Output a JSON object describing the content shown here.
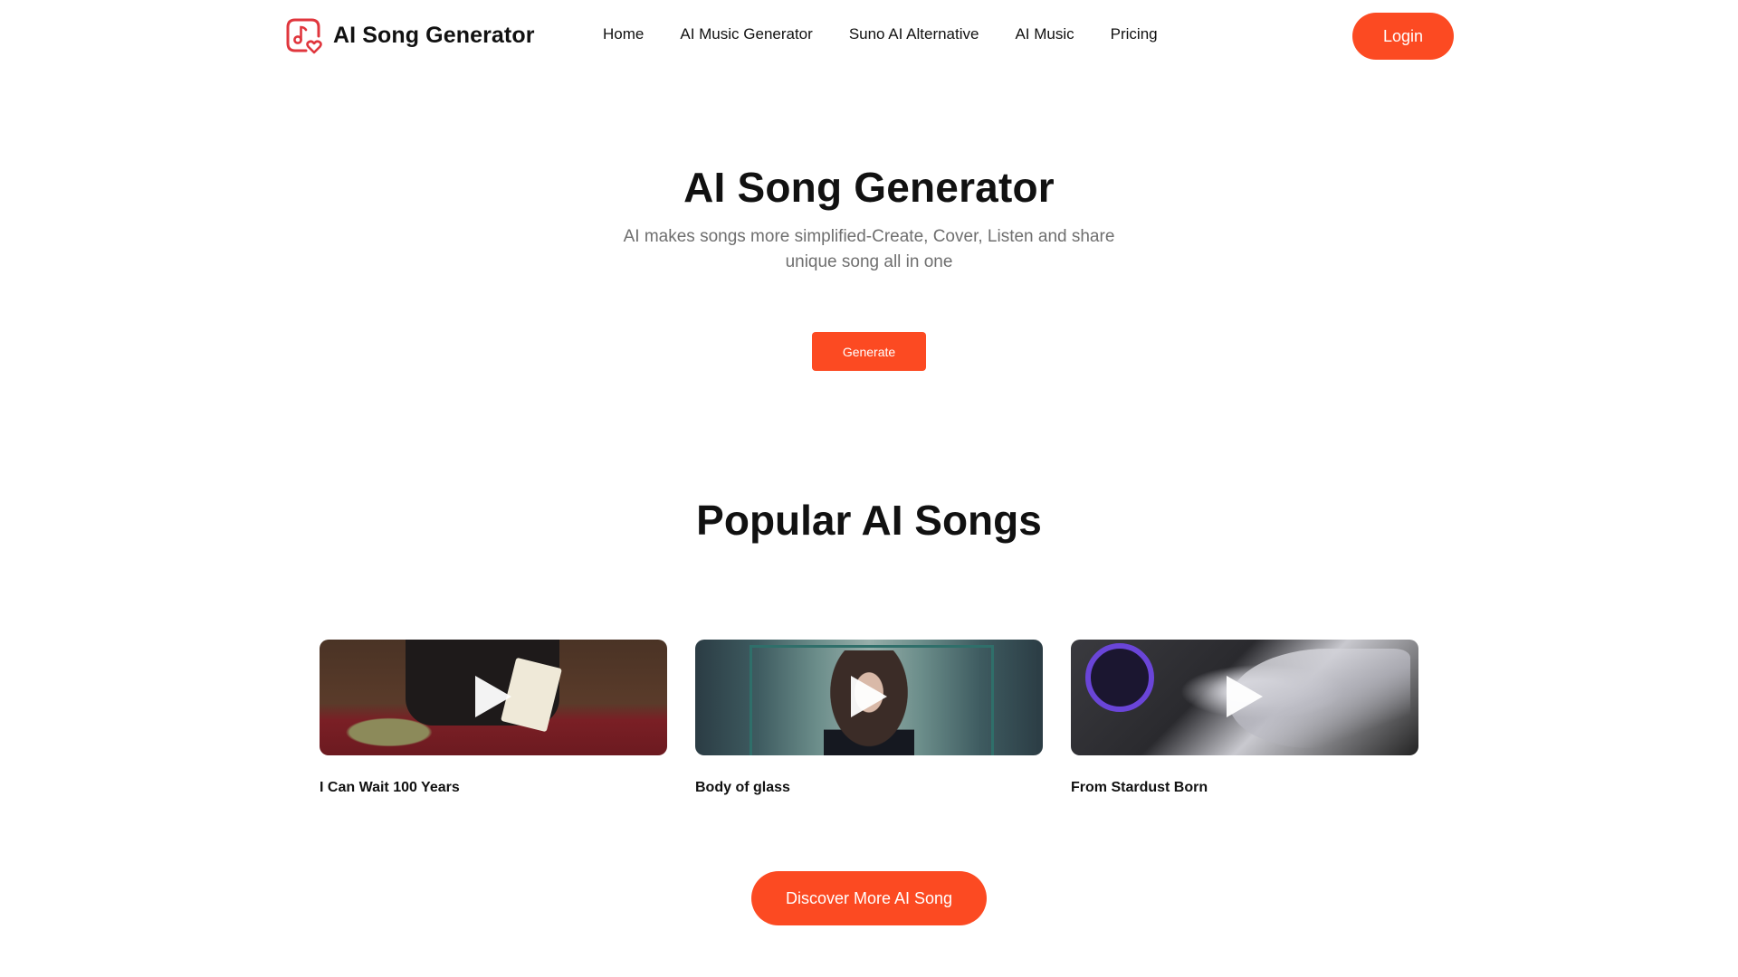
{
  "header": {
    "logo_icon": "music-note-heart-icon",
    "brand": "AI Song Generator",
    "nav": [
      {
        "label": "Home"
      },
      {
        "label": "AI Music Generator"
      },
      {
        "label": "Suno AI Alternative"
      },
      {
        "label": "AI Music"
      },
      {
        "label": "Pricing"
      }
    ],
    "login_label": "Login"
  },
  "hero": {
    "title": "AI Song Generator",
    "subtitle": "AI makes songs more simplified-Create, Cover, Listen and share unique song all in one",
    "generate_label": "Generate"
  },
  "popular": {
    "title": "Popular AI Songs",
    "songs": [
      {
        "title": "I Can Wait 100 Years",
        "thumbnail": "poker-table-ace-card",
        "play_icon": "play-icon"
      },
      {
        "title": "Body of glass",
        "thumbnail": "woman-in-glass-box-city",
        "play_icon": "play-icon"
      },
      {
        "title": "From Stardust Born",
        "thumbnail": "silver-winged-figure-space",
        "play_icon": "play-icon"
      }
    ],
    "discover_label": "Discover More AI Song"
  },
  "colors": {
    "accent": "#fc4a22",
    "text": "#111111",
    "muted": "#6f6f6f",
    "logo": "#e0363d"
  }
}
